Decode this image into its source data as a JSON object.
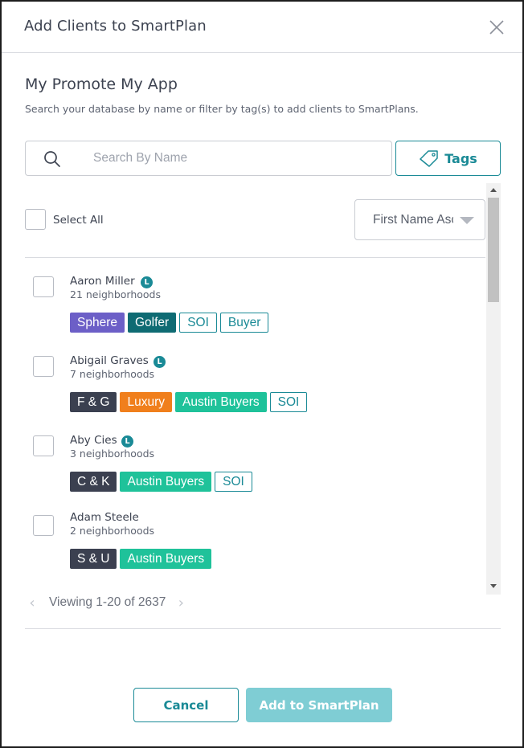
{
  "modal": {
    "title": "Add Clients to SmartPlan",
    "close_icon": "close-icon"
  },
  "section": {
    "title": "My Promote My App",
    "description": "Search your database by name or filter by tag(s) to add clients to SmartPlans."
  },
  "search": {
    "placeholder": "Search By Name",
    "value": "",
    "icon": "search-icon"
  },
  "tags_button": {
    "label": "Tags",
    "icon": "tag-icon"
  },
  "list": {
    "select_all_label": "Select All",
    "sort_selected": "First Name Ascending",
    "clients": [
      {
        "name": "Aaron Miller",
        "lead_badge": "L",
        "neighborhoods": "21 neighborhoods",
        "tags": [
          {
            "label": "Sphere",
            "style": "solid",
            "color": "#6c5fc7"
          },
          {
            "label": "Golfer",
            "style": "solid",
            "color": "#0f6b73"
          },
          {
            "label": "SOI",
            "style": "outline",
            "color": "#1a8a96"
          },
          {
            "label": "Buyer",
            "style": "outline",
            "color": "#1a8a96"
          }
        ]
      },
      {
        "name": "Abigail Graves",
        "lead_badge": "L",
        "neighborhoods": "7 neighborhoods",
        "tags": [
          {
            "label": "F & G",
            "style": "solid",
            "color": "#3b4050"
          },
          {
            "label": "Luxury",
            "style": "solid",
            "color": "#f07f1c"
          },
          {
            "label": "Austin Buyers",
            "style": "solid",
            "color": "#1fc29a"
          },
          {
            "label": "SOI",
            "style": "outline",
            "color": "#1a8a96"
          }
        ]
      },
      {
        "name": "Aby Cies",
        "lead_badge": "L",
        "neighborhoods": "3 neighborhoods",
        "tags": [
          {
            "label": "C & K",
            "style": "solid",
            "color": "#3b4050"
          },
          {
            "label": "Austin Buyers",
            "style": "solid",
            "color": "#1fc29a"
          },
          {
            "label": "SOI",
            "style": "outline",
            "color": "#1a8a96"
          }
        ]
      },
      {
        "name": "Adam Steele",
        "lead_badge": "",
        "neighborhoods": "2 neighborhoods",
        "tags": [
          {
            "label": "S & U",
            "style": "solid",
            "color": "#3b4050"
          },
          {
            "label": "Austin Buyers",
            "style": "solid",
            "color": "#1fc29a"
          }
        ]
      }
    ]
  },
  "pagination": {
    "text": "Viewing 1-20 of 2637",
    "prev_icon": "chevron-left-icon",
    "next_icon": "chevron-right-icon"
  },
  "footer": {
    "cancel_label": "Cancel",
    "submit_label": "Add to SmartPlan"
  },
  "colors": {
    "accent": "#1a8a96",
    "submit_disabled": "#7fcdd4"
  }
}
